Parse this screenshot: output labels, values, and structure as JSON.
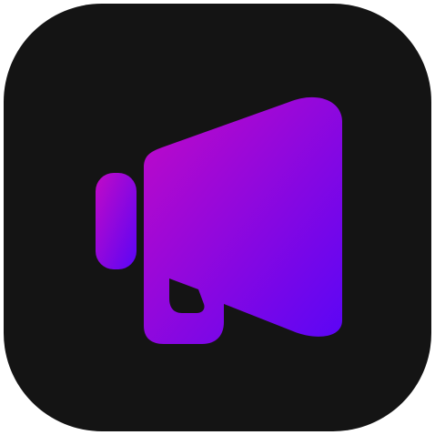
{
  "icon": {
    "name": "megaphone-icon",
    "background_color": "#141414",
    "gradient_start": "#c20ac6",
    "gradient_end": "#5a05f6"
  }
}
